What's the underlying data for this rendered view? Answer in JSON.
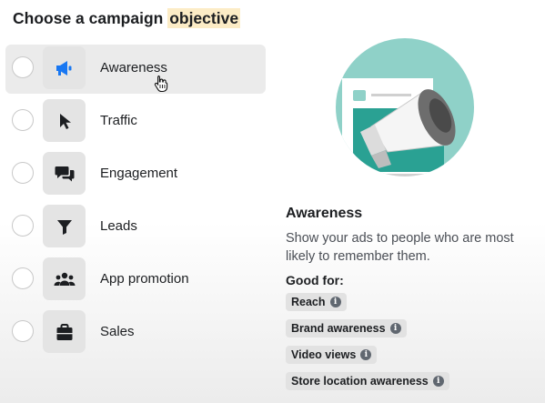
{
  "page": {
    "title_prefix": "Choose a campaign ",
    "title_highlight": "objective"
  },
  "objectives": [
    {
      "label": "Awareness",
      "icon": "megaphone-icon",
      "selected": true
    },
    {
      "label": "Traffic",
      "icon": "cursor-arrow-icon",
      "selected": false
    },
    {
      "label": "Engagement",
      "icon": "chat-bubbles-icon",
      "selected": false
    },
    {
      "label": "Leads",
      "icon": "funnel-icon",
      "selected": false
    },
    {
      "label": "App promotion",
      "icon": "people-group-icon",
      "selected": false
    },
    {
      "label": "Sales",
      "icon": "shopping-bag-icon",
      "selected": false
    }
  ],
  "detail": {
    "title": "Awareness",
    "description": "Show your ads to people who are most likely to remember them.",
    "good_for_label": "Good for:",
    "good_for": [
      "Reach",
      "Brand awareness",
      "Video views",
      "Store location awareness"
    ]
  },
  "colors": {
    "accent_blue": "#1877f2",
    "illustration_teal": "#2aa193",
    "illustration_bg": "#8fd1c8",
    "highlight": "#fcecc6"
  }
}
